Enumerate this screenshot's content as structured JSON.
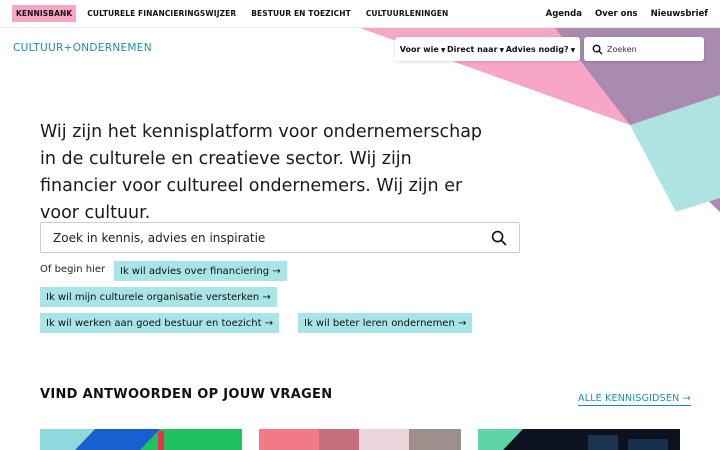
{
  "topbar": {
    "tags": [
      "KENNISBANK",
      "CULTURELE FINANCIERINGSWIJZER",
      "BESTUUR EN TOEZICHT",
      "CULTUURLENINGEN"
    ],
    "links": [
      "Agenda",
      "Over ons",
      "Nieuwsbrief"
    ]
  },
  "header": {
    "logo": "CULTUUR+ONDERNEMEN",
    "nav": [
      "Voor wie",
      "Direct naar",
      "Advies nodig?"
    ],
    "search_placeholder": "Zoeken"
  },
  "hero": {
    "text": "Wij zijn het kennisplatform voor ondernemerschap in de culturele en creatieve sector. Wij zijn financier voor cultureel ondernemers. Wij zijn er voor cultuur.",
    "search_placeholder": "Zoek in kennis, advies en inspiratie",
    "begin_label": "Of begin hier",
    "chips": [
      "Ik wil advies over financiering →",
      "Ik wil mijn culturele organisatie versterken →",
      "Ik wil werken aan goed bestuur en toezicht →",
      "Ik wil beter leren ondernemen →"
    ]
  },
  "section": {
    "title": "VIND ANTWOORDEN OP JOUW VRAGEN",
    "all_link": "ALLE KENNISGIDSEN →"
  },
  "colors": {
    "accent": "#1d8fa3",
    "pink": "#f7a6c8",
    "mauve": "#a98bb0",
    "teal_light": "#a9e4e6"
  }
}
